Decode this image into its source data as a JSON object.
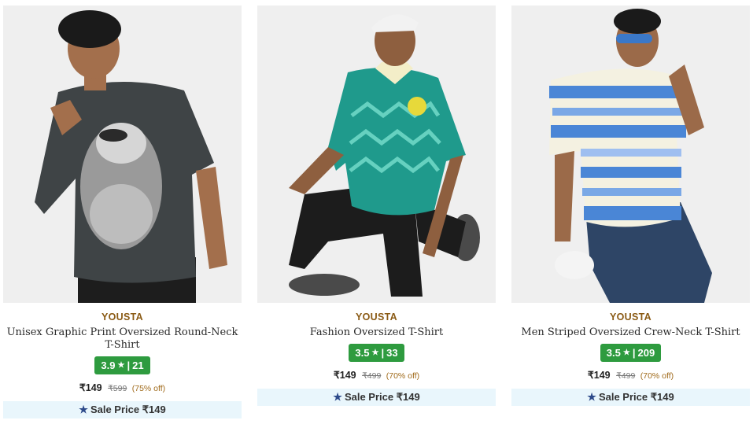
{
  "products": [
    {
      "brand": "YOUSTA",
      "title": "Unisex Graphic Print Oversized Round-Neck T-Shirt",
      "rating": "3.9",
      "reviews": "21",
      "price": "₹149",
      "mrp": "₹599",
      "discount": "(75% off)",
      "sale_label": "Sale Price ₹149",
      "image_alt": "Model wearing grey graphic print oversized t-shirt",
      "shirt_color": "#3f4446"
    },
    {
      "brand": "YOUSTA",
      "title": "Fashion Oversized T-Shirt",
      "rating": "3.5",
      "reviews": "33",
      "price": "₹149",
      "mrp": "₹499",
      "discount": "(70% off)",
      "sale_label": "Sale Price ₹149",
      "image_alt": "Model wearing teal chevron oversized t-shirt",
      "shirt_color": "#1f9a8c"
    },
    {
      "brand": "YOUSTA",
      "title": "Men Striped Oversized Crew-Neck T-Shirt",
      "rating": "3.5",
      "reviews": "209",
      "price": "₹149",
      "mrp": "₹499",
      "discount": "(70% off)",
      "sale_label": "Sale Price ₹149",
      "image_alt": "Model wearing blue and white striped oversized t-shirt",
      "shirt_color": "#4a86d6"
    }
  ],
  "icons": {
    "rating_star": "★",
    "sale_star": "★"
  },
  "colors": {
    "rating_bg": "#2e9b3f",
    "brand": "#8a5a14",
    "sale_bg": "#e9f6fc",
    "discount": "#a06a1a"
  }
}
